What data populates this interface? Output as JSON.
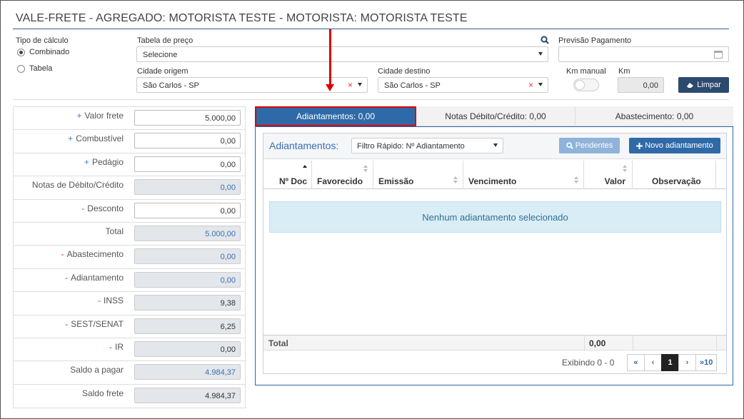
{
  "header": {
    "title": "VALE-FRETE - AGREGADO: MOTORISTA TESTE - MOTORISTA: MOTORISTA TESTE"
  },
  "form": {
    "tipo_calculo_label": "Tipo de cálculo",
    "radio_combinado": "Combinado",
    "radio_tabela": "Tabela",
    "tabela_preco_label": "Tabela de preço",
    "tabela_preco_value": "Selecione",
    "previsao_label": "Previsão Pagamento",
    "previsao_value": "",
    "cidade_origem_label": "Cidade origem",
    "cidade_origem_value": "São Carlos - SP",
    "cidade_destino_label": "Cidade destino",
    "cidade_destino_value": "São Carlos - SP",
    "km_manual_label": "Km manual",
    "km_label": "Km",
    "km_value": "0,00",
    "limpar_label": "Limpar",
    "clear_glyph": "×"
  },
  "values": [
    {
      "sign": "+",
      "label": "Valor frete",
      "value": "5.000,00"
    },
    {
      "sign": "+",
      "label": "Combustível",
      "value": "0,00"
    },
    {
      "sign": "+",
      "label": "Pedágio",
      "value": "0,00"
    },
    {
      "sign": "",
      "label": "Notas de Débito/Crédito",
      "value": "0,00"
    },
    {
      "sign": "-",
      "label": "Desconto",
      "value": "0,00"
    },
    {
      "sign": "",
      "label": "Total",
      "value": "5.000,00"
    },
    {
      "sign": "-",
      "label": "Abastecimento",
      "value": "0,00"
    },
    {
      "sign": "-",
      "label": "Adiantamento",
      "value": "0,00"
    },
    {
      "sign": "-",
      "label": "INSS",
      "value": "9,38"
    },
    {
      "sign": "-",
      "label": "SEST/SENAT",
      "value": "6,25"
    },
    {
      "sign": "-",
      "label": "IR",
      "value": "0,00"
    },
    {
      "sign": "",
      "label": "Saldo a pagar",
      "value": "4.984,37"
    },
    {
      "sign": "",
      "label": "Saldo frete",
      "value": "4.984,37"
    }
  ],
  "tabs": {
    "adiantamentos": "Adiantamentos: 0,00",
    "notas": "Notas Débito/Crédito: 0,00",
    "abastecimento": "Abastecimento: 0,00"
  },
  "panel": {
    "title": "Adiantamentos:",
    "filter_value": "Filtro Rápido: Nº Adiantamento",
    "pendentes_label": "Pendentes",
    "novo_label": "Novo adiantamento",
    "columns": {
      "ndoc": "Nº Doc",
      "favorecido": "Favorecido",
      "emissao": "Emissão",
      "vencimento": "Vencimento",
      "valor": "Valor",
      "observacao": "Observação"
    },
    "empty_message": "Nenhum adiantamento selecionado",
    "total_label": "Total",
    "total_value": "0,00",
    "pager_info": "Exibindo 0 - 0",
    "pager": {
      "first": "«",
      "prev": "‹",
      "current": "1",
      "next": "›",
      "last": "»10"
    }
  },
  "colors": {
    "accent": "#2f6aa8",
    "dark_button": "#2c4a6e",
    "highlight": "#dd0000"
  }
}
